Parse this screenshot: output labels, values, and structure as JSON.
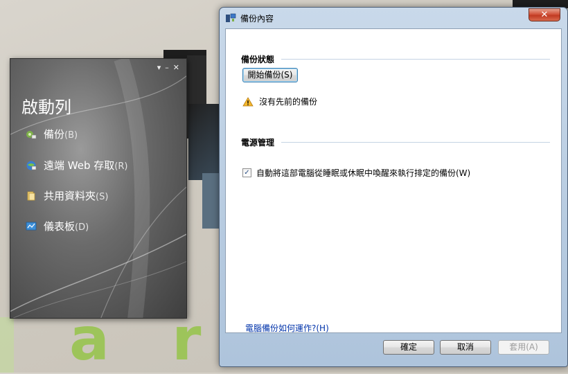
{
  "launchpad": {
    "title": "啟動列",
    "items": [
      {
        "label": "備份",
        "key": "(B)",
        "icon": "backup-icon"
      },
      {
        "label": "遠端 Web 存取",
        "key": "(R)",
        "icon": "remote-web-access-icon"
      },
      {
        "label": "共用資料夾",
        "key": "(S)",
        "icon": "shared-folders-icon"
      },
      {
        "label": "儀表板",
        "key": "(D)",
        "icon": "dashboard-icon"
      }
    ],
    "controls": {
      "pin": "▾",
      "minimize": "–",
      "close": "✕"
    }
  },
  "dialog": {
    "title": "備份內容",
    "close_symbol": "✕",
    "backup_status": {
      "heading": "備份狀態",
      "start_button": "開始備份(S)",
      "warning_text": "沒有先前的備份"
    },
    "power": {
      "heading": "電源管理",
      "checkbox_checked": true,
      "checkbox_mark": "✓",
      "checkbox_label": "自動將這部電腦從睡眠或休眠中喚醒來執行排定的備份(W)"
    },
    "help_link": "電腦備份如何運作?(H)",
    "buttons": {
      "ok": "確定",
      "cancel": "取消",
      "apply": "套用(A)"
    }
  },
  "background_letters": [
    "a",
    "r"
  ]
}
